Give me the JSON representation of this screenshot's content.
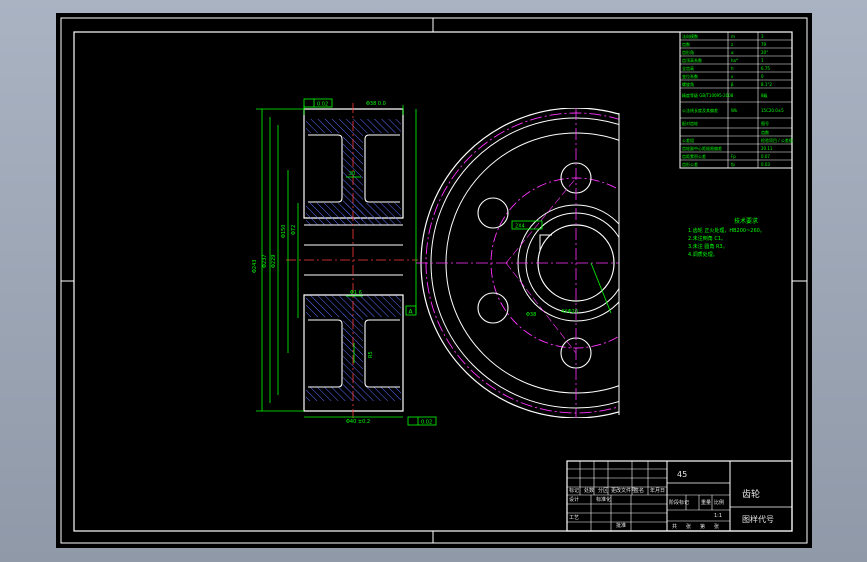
{
  "params_table": {
    "rows": [
      {
        "name": "法向模数",
        "symbol": "m",
        "value": "3"
      },
      {
        "name": "齿数",
        "symbol": "z",
        "value": "79"
      },
      {
        "name": "齿形角",
        "symbol": "α",
        "value": "20°"
      },
      {
        "name": "齿顶高系数",
        "symbol": "ha*",
        "value": "1"
      },
      {
        "name": "全齿高",
        "symbol": "h",
        "value": "6.75"
      },
      {
        "name": "变位系数",
        "symbol": "x",
        "value": "0"
      },
      {
        "name": "螺旋角",
        "symbol": "β",
        "value": "8.1°2"
      },
      {
        "name": "精度等级 GB/T10095-2008",
        "symbol": "",
        "value": "8级"
      },
      {
        "name": "公法线长度及其偏差",
        "symbol": "Wk",
        "value": "15C20.0±5"
      },
      {
        "name": "配对齿轮",
        "symbol": "",
        "value": "图号"
      },
      {
        "name": "",
        "symbol": "",
        "value": "齿数"
      },
      {
        "name": "公差组",
        "symbol": "",
        "value": "检验项目 / 公差值"
      },
      {
        "name": "齿轮副中心距极限偏差",
        "symbol": "",
        "value": "20.11"
      },
      {
        "name": "齿距累积公差",
        "symbol": "Fp",
        "value": "0.07"
      },
      {
        "name": "齿形公差",
        "symbol": "fp",
        "value": "0.03"
      }
    ]
  },
  "tech_requirements": {
    "title": "技术要求",
    "items": [
      "1.齿轮 正火处理，HB200~260。",
      "2.未注倒角 C1。",
      "3.未注 圆角 R3。",
      "4.调质处理。"
    ]
  },
  "title_block": {
    "material": "45",
    "part_name": "齿轮",
    "drawing_code": "图样代号",
    "header_labels": [
      "标记",
      "处数",
      "分区",
      "更改文件号",
      "签名",
      "年月日"
    ],
    "design_label": "设计",
    "standard_label": "标准化",
    "process_label": "工艺",
    "approve_label": "批准",
    "stage_label": "阶段标记",
    "weight_label": "重量",
    "scale_label": "比例",
    "scale_value": "1:1",
    "sheet_labels": [
      "共",
      "张",
      "第",
      "张"
    ]
  },
  "dimensions": {
    "top_tolerance": "0.02",
    "bottom_tolerance": "0.02",
    "datum": "A",
    "hub_width": "20",
    "keyway": "2X4",
    "holes": "4XΦ20",
    "bore_label": "Φ38"
  }
}
